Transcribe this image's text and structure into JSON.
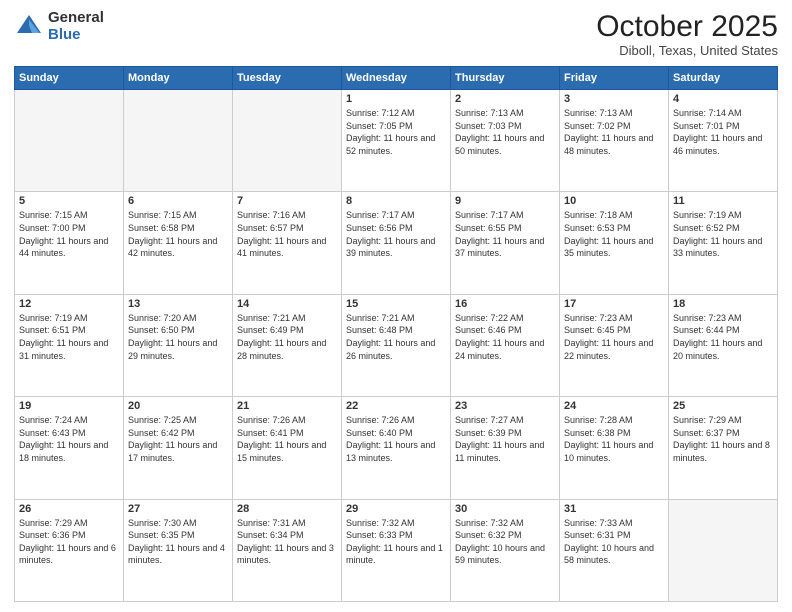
{
  "header": {
    "logo_general": "General",
    "logo_blue": "Blue",
    "month_title": "October 2025",
    "location": "Diboll, Texas, United States"
  },
  "days_of_week": [
    "Sunday",
    "Monday",
    "Tuesday",
    "Wednesday",
    "Thursday",
    "Friday",
    "Saturday"
  ],
  "weeks": [
    [
      {
        "day": "",
        "sunrise": "",
        "sunset": "",
        "daylight": "",
        "empty": true
      },
      {
        "day": "",
        "sunrise": "",
        "sunset": "",
        "daylight": "",
        "empty": true
      },
      {
        "day": "",
        "sunrise": "",
        "sunset": "",
        "daylight": "",
        "empty": true
      },
      {
        "day": "1",
        "sunrise": "Sunrise: 7:12 AM",
        "sunset": "Sunset: 7:05 PM",
        "daylight": "Daylight: 11 hours and 52 minutes."
      },
      {
        "day": "2",
        "sunrise": "Sunrise: 7:13 AM",
        "sunset": "Sunset: 7:03 PM",
        "daylight": "Daylight: 11 hours and 50 minutes."
      },
      {
        "day": "3",
        "sunrise": "Sunrise: 7:13 AM",
        "sunset": "Sunset: 7:02 PM",
        "daylight": "Daylight: 11 hours and 48 minutes."
      },
      {
        "day": "4",
        "sunrise": "Sunrise: 7:14 AM",
        "sunset": "Sunset: 7:01 PM",
        "daylight": "Daylight: 11 hours and 46 minutes."
      }
    ],
    [
      {
        "day": "5",
        "sunrise": "Sunrise: 7:15 AM",
        "sunset": "Sunset: 7:00 PM",
        "daylight": "Daylight: 11 hours and 44 minutes."
      },
      {
        "day": "6",
        "sunrise": "Sunrise: 7:15 AM",
        "sunset": "Sunset: 6:58 PM",
        "daylight": "Daylight: 11 hours and 42 minutes."
      },
      {
        "day": "7",
        "sunrise": "Sunrise: 7:16 AM",
        "sunset": "Sunset: 6:57 PM",
        "daylight": "Daylight: 11 hours and 41 minutes."
      },
      {
        "day": "8",
        "sunrise": "Sunrise: 7:17 AM",
        "sunset": "Sunset: 6:56 PM",
        "daylight": "Daylight: 11 hours and 39 minutes."
      },
      {
        "day": "9",
        "sunrise": "Sunrise: 7:17 AM",
        "sunset": "Sunset: 6:55 PM",
        "daylight": "Daylight: 11 hours and 37 minutes."
      },
      {
        "day": "10",
        "sunrise": "Sunrise: 7:18 AM",
        "sunset": "Sunset: 6:53 PM",
        "daylight": "Daylight: 11 hours and 35 minutes."
      },
      {
        "day": "11",
        "sunrise": "Sunrise: 7:19 AM",
        "sunset": "Sunset: 6:52 PM",
        "daylight": "Daylight: 11 hours and 33 minutes."
      }
    ],
    [
      {
        "day": "12",
        "sunrise": "Sunrise: 7:19 AM",
        "sunset": "Sunset: 6:51 PM",
        "daylight": "Daylight: 11 hours and 31 minutes."
      },
      {
        "day": "13",
        "sunrise": "Sunrise: 7:20 AM",
        "sunset": "Sunset: 6:50 PM",
        "daylight": "Daylight: 11 hours and 29 minutes."
      },
      {
        "day": "14",
        "sunrise": "Sunrise: 7:21 AM",
        "sunset": "Sunset: 6:49 PM",
        "daylight": "Daylight: 11 hours and 28 minutes."
      },
      {
        "day": "15",
        "sunrise": "Sunrise: 7:21 AM",
        "sunset": "Sunset: 6:48 PM",
        "daylight": "Daylight: 11 hours and 26 minutes."
      },
      {
        "day": "16",
        "sunrise": "Sunrise: 7:22 AM",
        "sunset": "Sunset: 6:46 PM",
        "daylight": "Daylight: 11 hours and 24 minutes."
      },
      {
        "day": "17",
        "sunrise": "Sunrise: 7:23 AM",
        "sunset": "Sunset: 6:45 PM",
        "daylight": "Daylight: 11 hours and 22 minutes."
      },
      {
        "day": "18",
        "sunrise": "Sunrise: 7:23 AM",
        "sunset": "Sunset: 6:44 PM",
        "daylight": "Daylight: 11 hours and 20 minutes."
      }
    ],
    [
      {
        "day": "19",
        "sunrise": "Sunrise: 7:24 AM",
        "sunset": "Sunset: 6:43 PM",
        "daylight": "Daylight: 11 hours and 18 minutes."
      },
      {
        "day": "20",
        "sunrise": "Sunrise: 7:25 AM",
        "sunset": "Sunset: 6:42 PM",
        "daylight": "Daylight: 11 hours and 17 minutes."
      },
      {
        "day": "21",
        "sunrise": "Sunrise: 7:26 AM",
        "sunset": "Sunset: 6:41 PM",
        "daylight": "Daylight: 11 hours and 15 minutes."
      },
      {
        "day": "22",
        "sunrise": "Sunrise: 7:26 AM",
        "sunset": "Sunset: 6:40 PM",
        "daylight": "Daylight: 11 hours and 13 minutes."
      },
      {
        "day": "23",
        "sunrise": "Sunrise: 7:27 AM",
        "sunset": "Sunset: 6:39 PM",
        "daylight": "Daylight: 11 hours and 11 minutes."
      },
      {
        "day": "24",
        "sunrise": "Sunrise: 7:28 AM",
        "sunset": "Sunset: 6:38 PM",
        "daylight": "Daylight: 11 hours and 10 minutes."
      },
      {
        "day": "25",
        "sunrise": "Sunrise: 7:29 AM",
        "sunset": "Sunset: 6:37 PM",
        "daylight": "Daylight: 11 hours and 8 minutes."
      }
    ],
    [
      {
        "day": "26",
        "sunrise": "Sunrise: 7:29 AM",
        "sunset": "Sunset: 6:36 PM",
        "daylight": "Daylight: 11 hours and 6 minutes."
      },
      {
        "day": "27",
        "sunrise": "Sunrise: 7:30 AM",
        "sunset": "Sunset: 6:35 PM",
        "daylight": "Daylight: 11 hours and 4 minutes."
      },
      {
        "day": "28",
        "sunrise": "Sunrise: 7:31 AM",
        "sunset": "Sunset: 6:34 PM",
        "daylight": "Daylight: 11 hours and 3 minutes."
      },
      {
        "day": "29",
        "sunrise": "Sunrise: 7:32 AM",
        "sunset": "Sunset: 6:33 PM",
        "daylight": "Daylight: 11 hours and 1 minute."
      },
      {
        "day": "30",
        "sunrise": "Sunrise: 7:32 AM",
        "sunset": "Sunset: 6:32 PM",
        "daylight": "Daylight: 10 hours and 59 minutes."
      },
      {
        "day": "31",
        "sunrise": "Sunrise: 7:33 AM",
        "sunset": "Sunset: 6:31 PM",
        "daylight": "Daylight: 10 hours and 58 minutes."
      },
      {
        "day": "",
        "sunrise": "",
        "sunset": "",
        "daylight": "",
        "empty": true
      }
    ]
  ]
}
